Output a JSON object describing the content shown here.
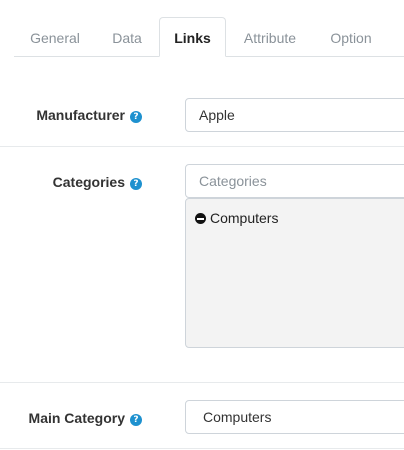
{
  "tabs": [
    {
      "label": "General"
    },
    {
      "label": "Data"
    },
    {
      "label": "Links"
    },
    {
      "label": "Attribute"
    },
    {
      "label": "Option"
    }
  ],
  "manufacturer": {
    "label": "Manufacturer",
    "value": "Apple"
  },
  "categories": {
    "label": "Categories",
    "placeholder": "Categories",
    "items": [
      {
        "label": "Computers"
      }
    ]
  },
  "main_category": {
    "label": "Main Category",
    "value": "Computers"
  },
  "help_icon": "?",
  "colors": {
    "accent": "#1e91cf"
  }
}
